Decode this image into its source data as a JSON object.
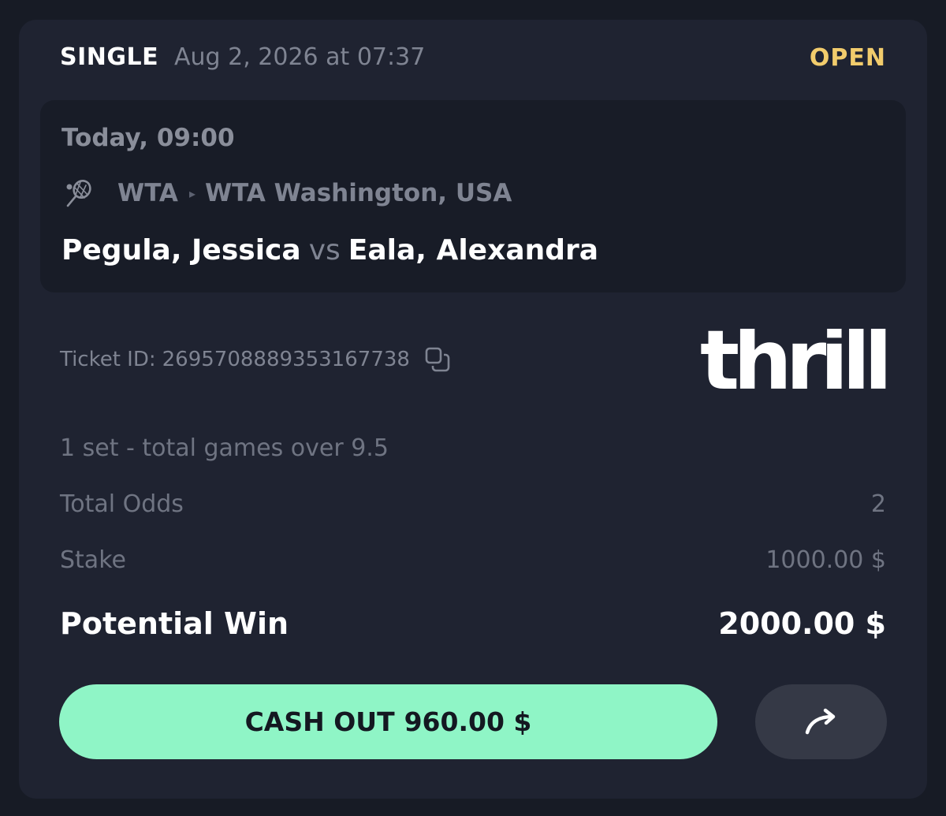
{
  "header": {
    "bet_type": "SINGLE",
    "placed_at": "Aug 2, 2026 at 07:37",
    "status": "OPEN",
    "status_color": "#f2cc6c"
  },
  "event": {
    "time": "Today, 09:00",
    "sport_icon": "tennis-racket-icon",
    "league": "WTA",
    "tournament": "WTA Washington, USA",
    "player_home": "Pegula, Jessica",
    "vs": "vs",
    "player_away": "Eala, Alexandra"
  },
  "ticket": {
    "label": "Ticket ID:",
    "id": "2695708889353167738",
    "copy_icon": "copy-icon"
  },
  "brand": {
    "name": "thrill"
  },
  "bet": {
    "market": "1 set - total games over 9.5",
    "total_odds_label": "Total Odds",
    "total_odds_value": "2",
    "stake_label": "Stake",
    "stake_value": "1000.00 $",
    "potential_win_label": "Potential Win",
    "potential_win_value": "2000.00 $"
  },
  "actions": {
    "cashout_label": "CASH OUT",
    "cashout_amount": "960.00 $",
    "cashout_color": "#8ff5c6",
    "share_icon": "share-arrow-icon"
  }
}
